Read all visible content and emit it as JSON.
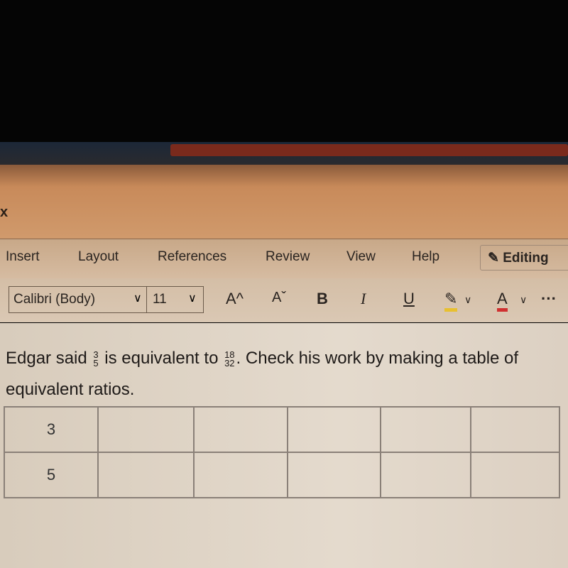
{
  "window": {
    "close_glyph": "x"
  },
  "ribbon": {
    "tabs": [
      "Insert",
      "Layout",
      "References",
      "Review",
      "View",
      "Help"
    ],
    "editing_label": "Editing"
  },
  "toolbar": {
    "font": "Calibri (Body)",
    "size": "11",
    "grow": "A^",
    "shrink": "Aˇ",
    "bold": "B",
    "italic": "I",
    "underline": "U",
    "font_color": "A",
    "more": "···",
    "highlight_color": "#e8c030",
    "font_color_bar": "#d03030"
  },
  "document": {
    "q_part1": "Edgar said ",
    "frac1": {
      "num": "3",
      "den": "5"
    },
    "q_part2": " is equivalent to ",
    "frac2": {
      "num": "18",
      "den": "32"
    },
    "q_part3": ". Check his work by making a table of equivalent ratios.",
    "table": [
      [
        "3",
        "",
        "",
        "",
        "",
        ""
      ],
      [
        "5",
        "",
        "",
        "",
        "",
        ""
      ]
    ]
  }
}
